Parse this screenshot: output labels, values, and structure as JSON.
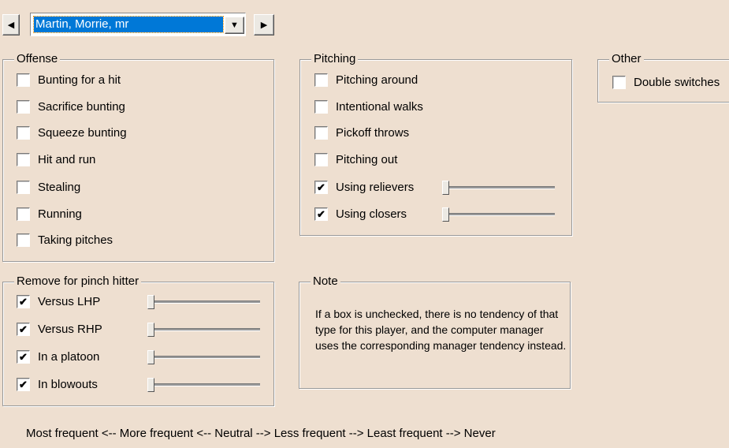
{
  "navigator": {
    "prev_icon": "triangle-left-icon",
    "next_icon": "triangle-right-icon",
    "player_selected": "Martin, Morrie, mr",
    "dropdown_icon": "chevron-down-icon"
  },
  "offense": {
    "title": "Offense",
    "items": [
      {
        "label": "Bunting for a hit",
        "checked": false
      },
      {
        "label": "Sacrifice bunting",
        "checked": false
      },
      {
        "label": "Squeeze bunting",
        "checked": false
      },
      {
        "label": "Hit and run",
        "checked": false
      },
      {
        "label": "Stealing",
        "checked": false
      },
      {
        "label": "Running",
        "checked": false
      },
      {
        "label": "Taking pitches",
        "checked": false
      }
    ]
  },
  "pitching": {
    "title": "Pitching",
    "items": [
      {
        "label": "Pitching around",
        "checked": false
      },
      {
        "label": "Intentional walks",
        "checked": false
      },
      {
        "label": "Pickoff throws",
        "checked": false
      },
      {
        "label": "Pitching out",
        "checked": false
      },
      {
        "label": "Using relievers",
        "checked": true,
        "slider": 0
      },
      {
        "label": "Using closers",
        "checked": true,
        "slider": 0
      }
    ]
  },
  "other": {
    "title": "Other",
    "items": [
      {
        "label": "Double switches",
        "checked": false
      }
    ]
  },
  "pinch": {
    "title": "Remove for pinch hitter",
    "items": [
      {
        "label": "Versus LHP",
        "checked": true,
        "slider": 0
      },
      {
        "label": "Versus RHP",
        "checked": true,
        "slider": 0
      },
      {
        "label": "In a platoon",
        "checked": true,
        "slider": 0
      },
      {
        "label": "In blowouts",
        "checked": true,
        "slider": 0
      }
    ]
  },
  "note": {
    "title": "Note",
    "text": "If a box is unchecked, there is no tendency of that type for this player, and the computer manager uses the corresponding manager tendency instead."
  },
  "legend": "Most frequent <-- More frequent <-- Neutral --> Less frequent --> Least frequent --> Never"
}
